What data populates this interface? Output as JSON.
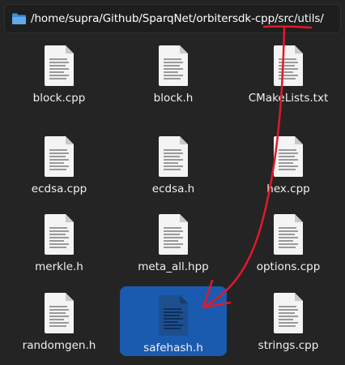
{
  "path_bar": {
    "path": "/home/supra/Github/SparqNet/orbitersdk-cpp/src/utils/",
    "icon": "folder-icon"
  },
  "files": [
    {
      "name": "block.cpp",
      "selected": false
    },
    {
      "name": "block.h",
      "selected": false
    },
    {
      "name": "CMakeLists.txt",
      "selected": false
    },
    {
      "name": "ecdsa.cpp",
      "selected": false
    },
    {
      "name": "ecdsa.h",
      "selected": false
    },
    {
      "name": "hex.cpp",
      "selected": false
    },
    {
      "name": "merkle.h",
      "selected": false
    },
    {
      "name": "meta_all.hpp",
      "selected": false
    },
    {
      "name": "options.cpp",
      "selected": false
    },
    {
      "name": "randomgen.h",
      "selected": false
    },
    {
      "name": "safehash.h",
      "selected": true
    },
    {
      "name": "strings.cpp",
      "selected": false
    }
  ],
  "colors": {
    "background": "#242424",
    "selection": "#1a5bb0",
    "annotation": "#e0192b"
  }
}
